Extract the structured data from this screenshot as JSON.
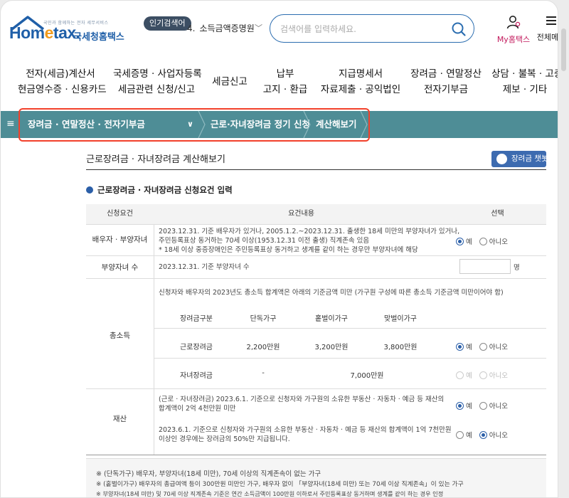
{
  "header": {
    "logo_small": "국민과 함께하는 전자 세무서비스",
    "logo_main_a": "Hom",
    "logo_main_e": "e",
    "logo_main_b": "tax.",
    "logo_kr": "국세청홈택스",
    "popular_label": "인기검색어",
    "popular_num": "4.",
    "popular_text": "소득금액증명원",
    "search_placeholder": "검색어를 입력하세요.",
    "my_hometax": "My홈택스",
    "all_menu": "전체메뉴"
  },
  "gnb": [
    {
      "line1": "전자(세금)계산서",
      "line2": "현금영수증 · 신용카드"
    },
    {
      "line1": "국세증명 · 사업자등록",
      "line2": "세금관련 신청/신고"
    },
    {
      "line1": "세금신고",
      "line2": ""
    },
    {
      "line1": "납부",
      "line2": "고지 · 환급"
    },
    {
      "line1": "지급명세서",
      "line2": "자료제출 · 공익법인"
    },
    {
      "line1": "장려금 · 연말정산",
      "line2": "전자기부금"
    },
    {
      "line1": "상담 · 불복 · 고충",
      "line2": "제보 · 기타"
    }
  ],
  "breadcrumb": {
    "item1": "장려금 · 연말정산 · 전자기부금",
    "item2": "근로·자녀장려금 정기 신청",
    "item3": "계산해보기"
  },
  "page": {
    "title": "근로장려금 · 자녀장려금 계산해보기",
    "help_button": "장려금 챗봇",
    "section_title": "근로장려금 · 자녀장려금 신청요건 입력"
  },
  "table": {
    "headers": [
      "신청요건",
      "요건내용",
      "선택"
    ],
    "row1": {
      "label": "배우자 · 부양자녀",
      "lines": [
        "2023.12.31. 기준 배우자가 있거나, 2005.1.2.~2023.12.31. 출생한 18세 미만의 부양자녀가 있거나,",
        "주민등록표상 동거하는 70세 이상(1953.12.31 이전 출생) 직계존속 있음",
        "* 18세 이상 중증장애인은 주민등록표상 동거하고 생계를 같이 하는 경우만 부양자녀에 해당"
      ],
      "yes": "예",
      "no": "아니오"
    },
    "row2": {
      "label": "부양자녀 수",
      "text": "2023.12.31. 기준 부양자녀 수",
      "unit": "명"
    },
    "row3": {
      "label": "총소득",
      "intro": "신청자와 배우자의 2023년도 총소득 합계액은 아래의 기준금액 미만 (가구원 구성에 따른 총소득 기준금액 미만이어야 함)",
      "col_headers": [
        "장려금구분",
        "단독가구",
        "홑벌이가구",
        "맞벌이가구"
      ],
      "rows": [
        {
          "name": "근로장려금",
          "single": "2,200만원",
          "one": "3,200만원",
          "dual": "3,800만원"
        },
        {
          "name": "자녀장려금",
          "single": "-",
          "combined": "7,000만원"
        }
      ],
      "yes": "예",
      "no": "아니오"
    },
    "row4": {
      "label": "재산",
      "a_lines": [
        "(근로 · 자녀장려금) 2023.6.1. 기준으로 신청자와 가구원의 소유한 부동산 · 자동차 · 예금 등 재산의",
        "합계액이 2억 4천만원 미만"
      ],
      "b_lines": [
        "2023.6.1. 기준으로 신청자와 가구원의 소유한 부동산 · 자동차 · 예금 등 재산의 합계액이 1억 7천만원",
        "이상인 경우에는 장려금의 50%만 지급됩니다."
      ],
      "yes": "예",
      "no": "아니오"
    }
  },
  "notes": [
    "※ (단독가구) 배우자, 부양자녀(18세 미만), 70세 이상의 직계존속이 없는 가구",
    "※ (홑벌이가구) 배우자의 총급여액 등이 300만원 미만인 가구, 배우자 없이 「부양자녀(18세 미만) 또는 70세 이상 직계존속」이 있는 가구",
    "※ 부양자녀(18세 미만) 및 70세 이상 직계존속 기준은 연간 소득금액이 100만원 이하로서 주민등록표상 동거하며 생계를 같이 하는 경우 인정"
  ]
}
